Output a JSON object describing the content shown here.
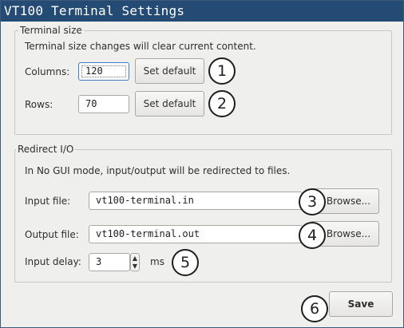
{
  "window": {
    "title": "VT100 Terminal Settings"
  },
  "terminal_size": {
    "title": "Terminal size",
    "note": "Terminal size changes will clear current content.",
    "columns_label": "Columns:",
    "columns_value": "120",
    "rows_label": "Rows:",
    "rows_value": "70",
    "set_default_label": "Set default"
  },
  "redirect_io": {
    "title": "Redirect I/O",
    "note": "In No GUI mode, input/output will be redirected to files.",
    "input_file_label": "Input file:",
    "input_file_value": "vt100-terminal.in",
    "output_file_label": "Output file:",
    "output_file_value": "vt100-terminal.out",
    "browse_label": "Browse...",
    "input_delay_label": "Input delay:",
    "input_delay_value": "3",
    "input_delay_unit": "ms"
  },
  "save_label": "Save",
  "markers": [
    "1",
    "2",
    "3",
    "4",
    "5",
    "6"
  ],
  "colors": {
    "titlebar": "#234b73",
    "focus": "#3d7cc7"
  },
  "icons": {
    "spin_up": "▲",
    "spin_down": "▼"
  }
}
